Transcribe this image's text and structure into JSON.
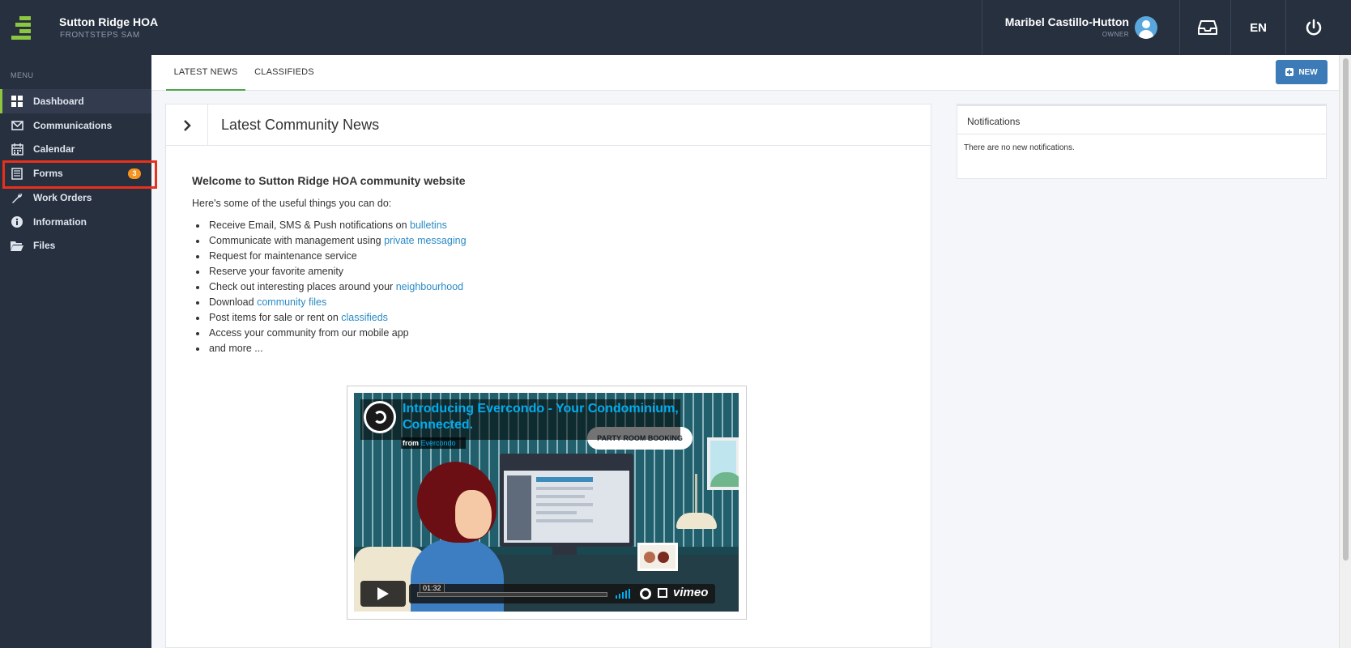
{
  "header": {
    "org_name": "Sutton Ridge HOA",
    "org_sub": "FRONTSTEPS SAM",
    "user_name": "Maribel Castillo-Hutton",
    "user_role": "OWNER",
    "language": "EN",
    "icons": [
      "logo-icon",
      "avatar",
      "inbox-icon",
      "power-icon"
    ]
  },
  "sidebar": {
    "menu_label": "MENU",
    "items": [
      {
        "label": "Dashboard",
        "icon": "dashboard-icon",
        "active": true
      },
      {
        "label": "Communications",
        "icon": "envelope-icon"
      },
      {
        "label": "Calendar",
        "icon": "calendar-icon"
      },
      {
        "label": "Forms",
        "icon": "form-icon",
        "badge": "3"
      },
      {
        "label": "Work Orders",
        "icon": "wrench-icon"
      },
      {
        "label": "Information",
        "icon": "info-icon"
      },
      {
        "label": "Files",
        "icon": "folder-icon"
      }
    ]
  },
  "tabs": {
    "latest_news": "LATEST NEWS",
    "classifieds": "CLASSIFIEDS",
    "new_button": "NEW"
  },
  "news": {
    "title": "Latest Community News",
    "welcome": "Welcome to Sutton Ridge HOA community website",
    "intro": "Here's some of the useful things you can do:",
    "items": [
      {
        "text": "Receive Email, SMS & Push notifications on ",
        "link": "bulletins"
      },
      {
        "text": "Communicate with management using ",
        "link": "private messaging"
      },
      {
        "text": "Request for maintenance service",
        "link": ""
      },
      {
        "text": "Reserve your favorite amenity",
        "link": ""
      },
      {
        "text": "Check out interesting places around your ",
        "link": "neighbourhood"
      },
      {
        "text": "Download ",
        "link": "community files"
      },
      {
        "text": "Post items for sale or rent on ",
        "link": "classifieds"
      },
      {
        "text": "Access your community from our mobile app",
        "link": ""
      },
      {
        "text": "and more ...",
        "link": ""
      }
    ]
  },
  "video": {
    "title": "Introducing Evercondo - Your Condominium, Connected.",
    "from_label": "from",
    "from_name": "Evercondo",
    "bubble": "PARTY ROOM BOOKING",
    "time": "01:32",
    "brand": "vimeo"
  },
  "notifications": {
    "title": "Notifications",
    "empty_text": "There are no new notifications."
  },
  "colors": {
    "topbar": "#27303f",
    "accent_green": "#8dc63f",
    "badge": "#f7941d",
    "link": "#2a8ac6",
    "new_button": "#3c7ab8",
    "highlight": "#e8301c"
  }
}
